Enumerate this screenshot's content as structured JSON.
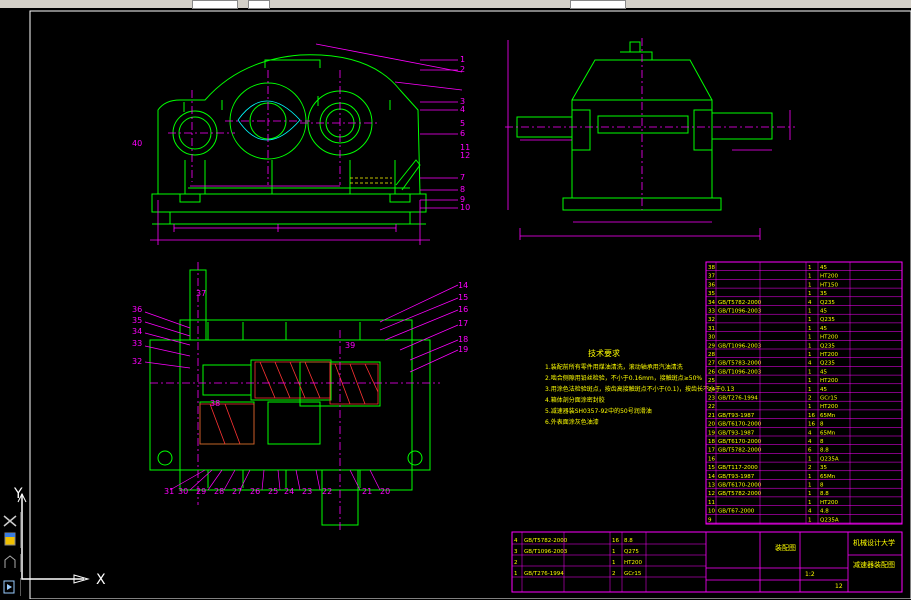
{
  "window": {
    "title": ""
  },
  "ucs": {
    "y_label": "Y",
    "x_label": "X"
  },
  "tech_req": {
    "title": "技术要求",
    "lines": [
      "1.装配前所有零件用煤油清洗，滚动轴承用汽油清洗",
      "2.啮合侧隙用铅丝检验，不小于0.16mm，接触斑点≥50%",
      "3.用涂色法检验斑点，按齿高接触斑点不小于(0.1)，按齿长不小于0.13",
      "4.箱体剖分面涂密封胶",
      "5.减速器装SH0357-92中的50号润滑油",
      "6.外表面涂灰色油漆"
    ]
  },
  "parts_table": {
    "rows": [
      [
        "38",
        "",
        "",
        "1",
        "45"
      ],
      [
        "37",
        "",
        "",
        "1",
        "HT200"
      ],
      [
        "36",
        "",
        "",
        "1",
        "HT150"
      ],
      [
        "35",
        "",
        "",
        "1",
        "35"
      ],
      [
        "34",
        "GB/T5782-2000",
        "",
        "4",
        "Q235"
      ],
      [
        "33",
        "GB/T1096-2003",
        "",
        "1",
        "45"
      ],
      [
        "32",
        "",
        "",
        "1",
        "Q235"
      ],
      [
        "31",
        "",
        "",
        "1",
        "45"
      ],
      [
        "30",
        "",
        "",
        "1",
        "HT200"
      ],
      [
        "29",
        "GB/T1096-2003",
        "",
        "1",
        "Q235"
      ],
      [
        "28",
        "",
        "",
        "1",
        "HT200"
      ],
      [
        "27",
        "GB/T5783-2000",
        "",
        "4",
        "Q235"
      ],
      [
        "26",
        "GB/T1096-2003",
        "",
        "1",
        "45"
      ],
      [
        "25",
        "",
        "",
        "1",
        "HT200"
      ],
      [
        "24",
        "",
        "",
        "1",
        "45"
      ],
      [
        "23",
        "GB/T276-1994",
        "",
        "2",
        "GCr15"
      ],
      [
        "22",
        "",
        "",
        "1",
        "HT200"
      ],
      [
        "21",
        "GB/T93-1987",
        "",
        "16",
        "65Mn"
      ],
      [
        "20",
        "GB/T6170-2000",
        "",
        "16",
        "8"
      ],
      [
        "19",
        "GB/T93-1987",
        "",
        "4",
        "65Mn"
      ],
      [
        "18",
        "GB/T6170-2000",
        "",
        "4",
        "8"
      ],
      [
        "17",
        "GB/T5782-2000",
        "",
        "6",
        "8.8"
      ],
      [
        "16",
        "",
        "",
        "1",
        "Q235A"
      ],
      [
        "15",
        "GB/T117-2000",
        "",
        "2",
        "35"
      ],
      [
        "14",
        "GB/T93-1987",
        "",
        "1",
        "65Mn"
      ],
      [
        "13",
        "GB/T6170-2000",
        "",
        "1",
        "8"
      ],
      [
        "12",
        "GB/T5782-2000",
        "",
        "1",
        "8.8"
      ],
      [
        "11",
        "",
        "",
        "1",
        "HT200"
      ],
      [
        "10",
        "GB/T67-2000",
        "",
        "4",
        "4.8"
      ],
      [
        "9",
        "",
        "",
        "1",
        "Q235A"
      ]
    ]
  },
  "title_block": {
    "left_rows": [
      [
        "4",
        "GB/T5782-2000",
        "",
        "16",
        "8.8"
      ],
      [
        "3",
        "GB/T1096-2003",
        "",
        "1",
        "Q275"
      ],
      [
        "2",
        "",
        "",
        "1",
        "HT200"
      ],
      [
        "1",
        "GB/T276-1994",
        "",
        "2",
        "GCr15"
      ]
    ],
    "drawing_name": "装配图",
    "school": "机械设计大学",
    "product": "减速器装配图",
    "scale": "1:2",
    "sheet": "12"
  },
  "balloons_front": [
    "1",
    "2",
    "3",
    "4",
    "5",
    "6",
    "7",
    "8",
    "9",
    "10",
    "11",
    "12",
    "40"
  ],
  "balloons_plan": [
    "14",
    "15",
    "16",
    "17",
    "18",
    "19",
    "20",
    "21",
    "22",
    "23",
    "24",
    "25",
    "26",
    "27",
    "28",
    "29",
    "30",
    "31",
    "32",
    "33",
    "34",
    "35",
    "36",
    "37",
    "38",
    "39"
  ],
  "colors": {
    "background": "#000000",
    "outline": "#00ff00",
    "dimension": "#ff00ff",
    "centerline": "#ff00ff",
    "hatch": "#ff3333",
    "hidden": "#ffff00",
    "table": "#ff00ff",
    "text": "#ffff00",
    "border": "#ffffff",
    "ucs": "#ffffff"
  }
}
